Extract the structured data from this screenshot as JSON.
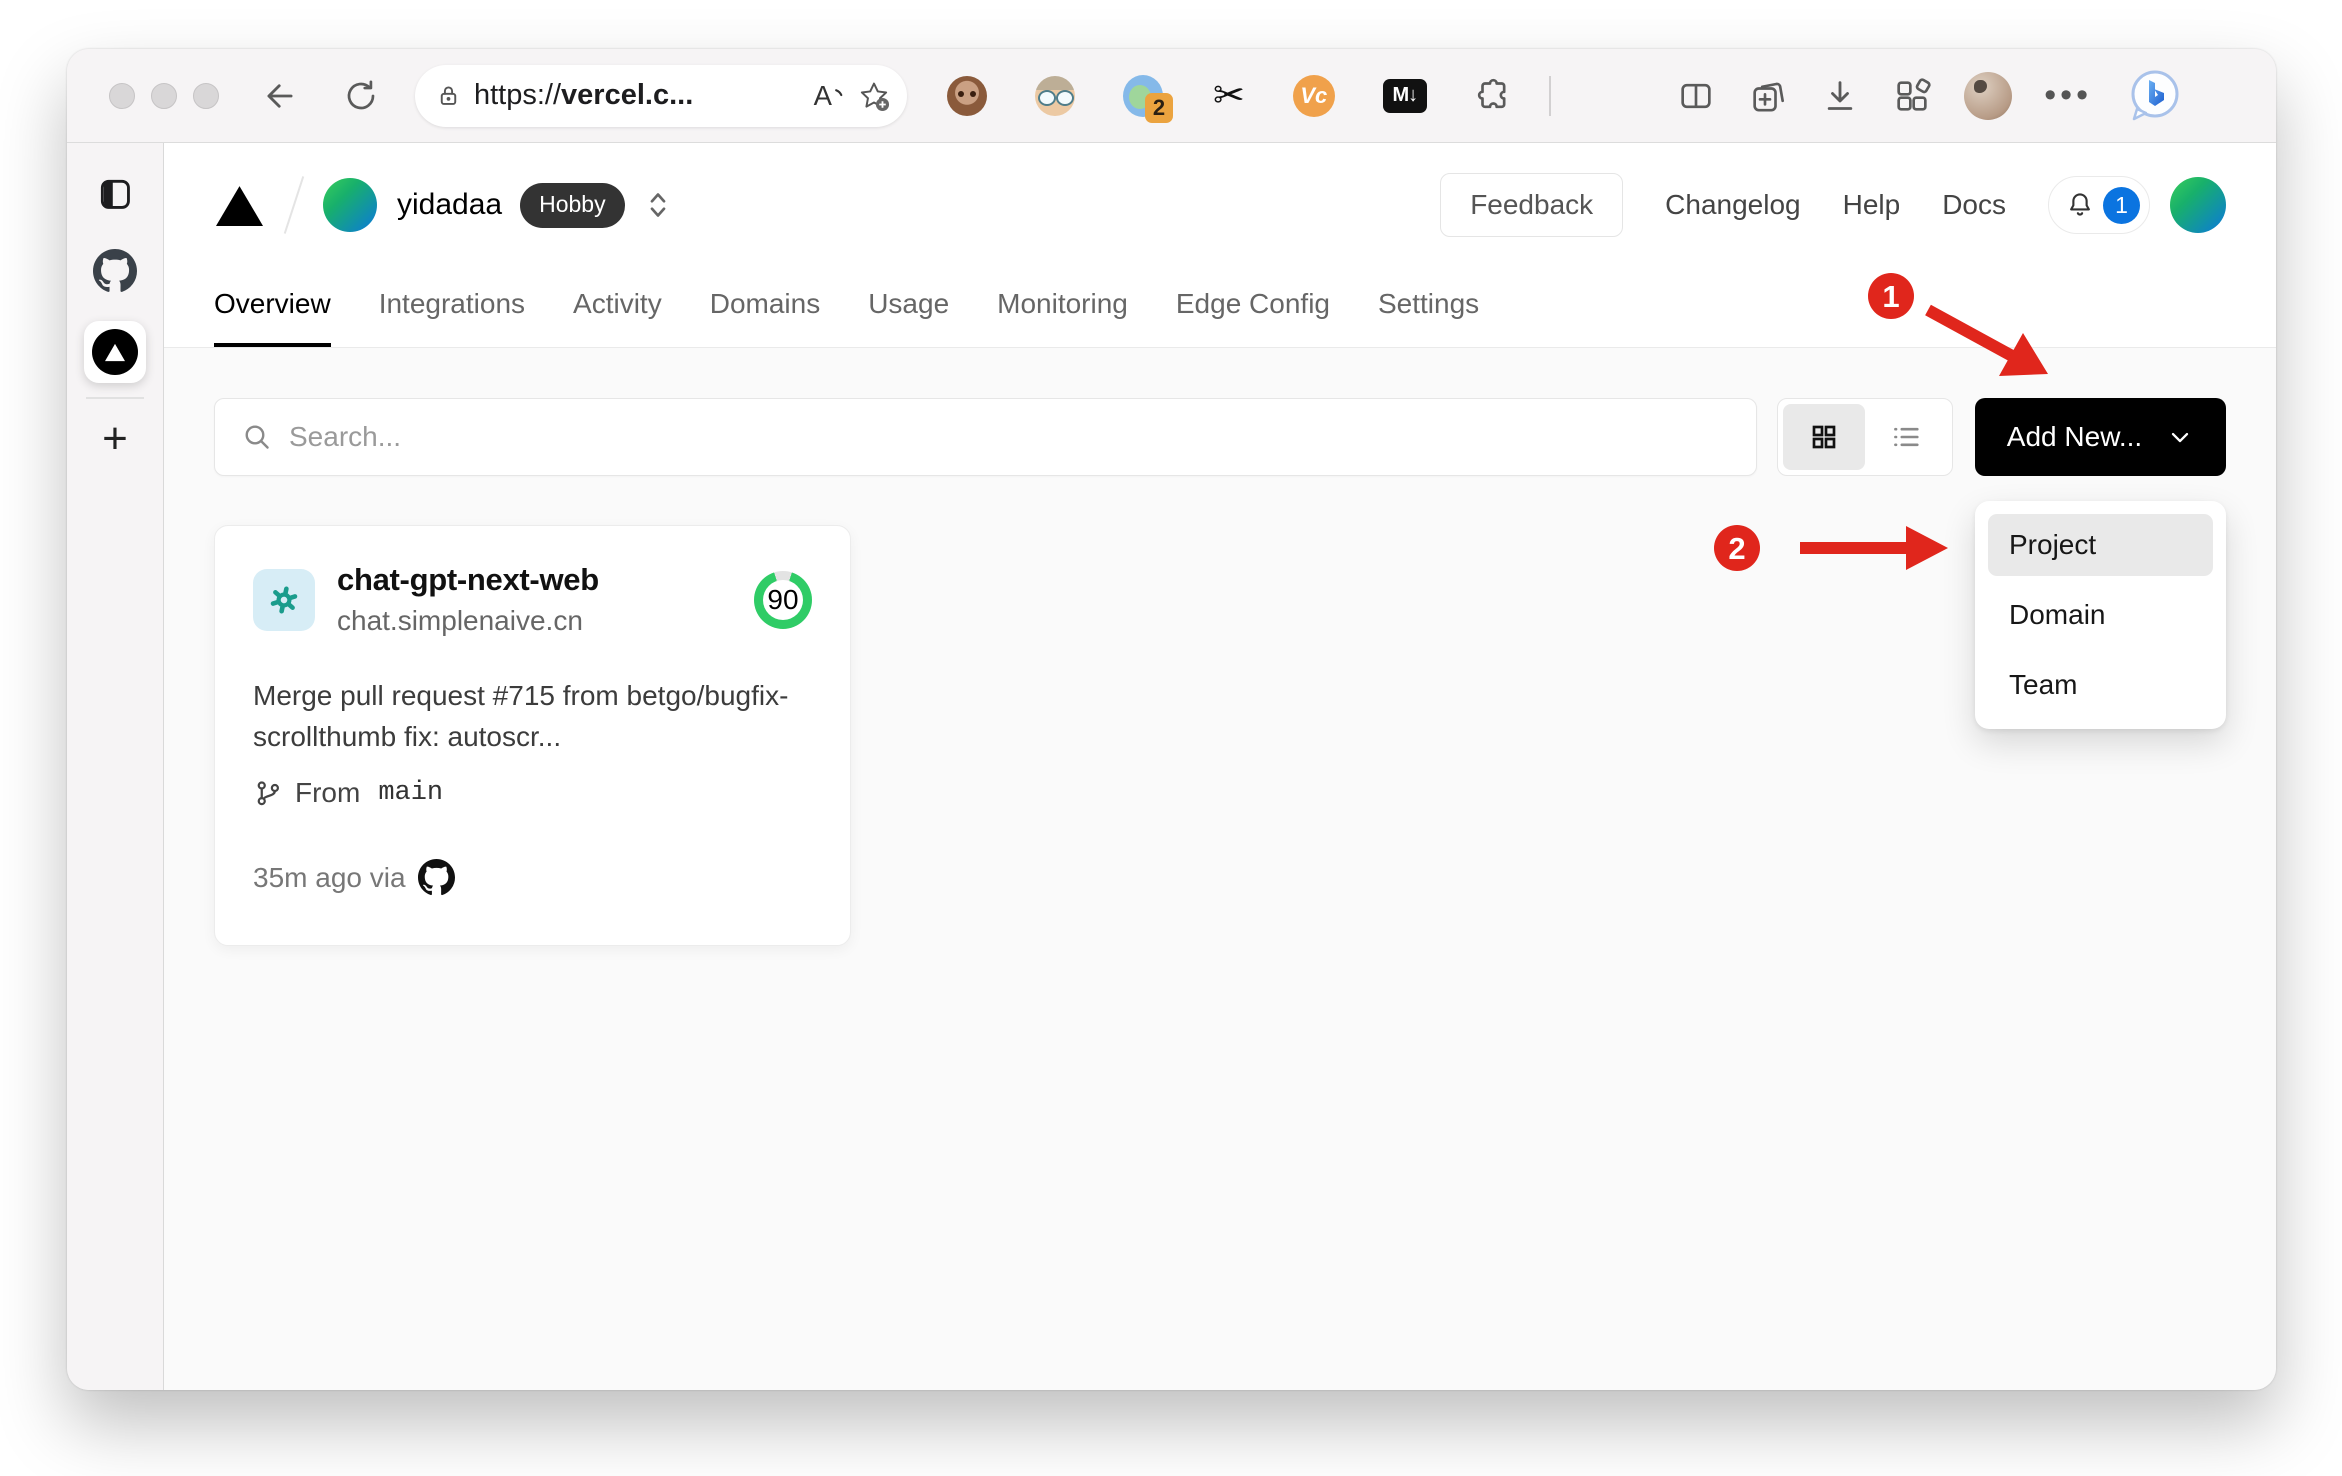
{
  "browser": {
    "url": {
      "scheme": "https://",
      "host": "vercel.c..."
    },
    "extensions": {
      "proxy_badge_count": "2",
      "scissors_glyph": "✂",
      "vc_label": "Vc",
      "markdown_label": "M↓"
    },
    "more_label": "•••"
  },
  "side_strip": {
    "plus_glyph": "+"
  },
  "header": {
    "team_name": "yidadaa",
    "plan_badge": "Hobby",
    "feedback_label": "Feedback",
    "links": [
      {
        "label": "Changelog"
      },
      {
        "label": "Help"
      },
      {
        "label": "Docs"
      }
    ],
    "notification_count": "1"
  },
  "nav": {
    "tabs": [
      {
        "label": "Overview",
        "active": true
      },
      {
        "label": "Integrations"
      },
      {
        "label": "Activity"
      },
      {
        "label": "Domains"
      },
      {
        "label": "Usage"
      },
      {
        "label": "Monitoring"
      },
      {
        "label": "Edge Config"
      },
      {
        "label": "Settings"
      }
    ]
  },
  "toolbar": {
    "search_placeholder": "Search...",
    "add_new_label": "Add New..."
  },
  "dropdown": {
    "items": [
      {
        "label": "Project",
        "highlighted": true
      },
      {
        "label": "Domain"
      },
      {
        "label": "Team"
      }
    ]
  },
  "project_card": {
    "name": "chat-gpt-next-web",
    "domain": "chat.simplenaive.cn",
    "score": "90",
    "commit_message": "Merge pull request #715 from betgo/bugfix-scrollthumb fix: autoscr...",
    "branch_prefix": "From",
    "branch": "main",
    "deployed": "35m ago via"
  },
  "annotations": {
    "step1": "1",
    "step2": "2"
  },
  "colors": {
    "annotation_red": "#e0261c",
    "score_green": "#2fcc66",
    "notification_blue": "#0b74e0",
    "hobby_badge_bg": "#333333",
    "add_new_bg": "#000000"
  }
}
